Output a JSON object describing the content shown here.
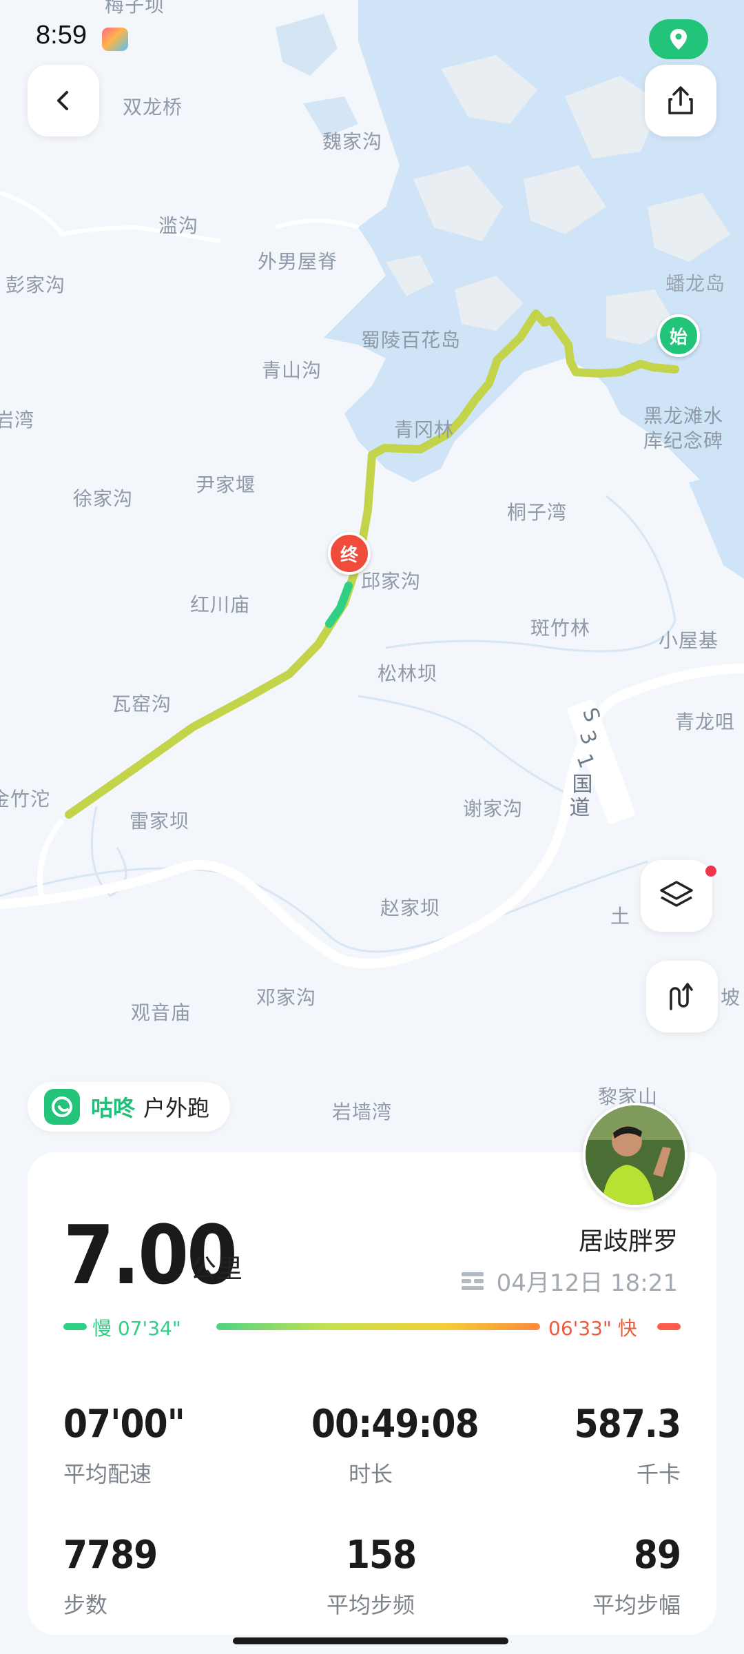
{
  "status": {
    "time": "8:59"
  },
  "map": {
    "labels": [
      "梅子坝",
      "双龙桥",
      "魏家沟",
      "滥沟",
      "外男屋脊",
      "彭家沟",
      "蟠龙岛",
      "蜀陵百花岛",
      "青山沟",
      "岩湾",
      "黑龙滩水",
      "库纪念碑",
      "青冈林",
      "尹家堰",
      "徐家沟",
      "桐子湾",
      "终",
      "邱家沟",
      "红川庙",
      "斑竹林",
      "小屋基",
      "松林坝",
      "瓦窑沟",
      "青龙咀",
      "金竹沱",
      "雷家坝",
      "谢家沟",
      "S",
      "3",
      "1",
      "国",
      "道",
      "赵家坝",
      "土",
      "观音庙",
      "邓家沟",
      "坡",
      "黎家山",
      "岩墙湾"
    ],
    "start_marker": "始",
    "end_marker": "终",
    "route_color": "#c3d34a"
  },
  "app": {
    "name": "咕咚",
    "activity": "户外跑"
  },
  "summary": {
    "distance": "7.00",
    "unit": "公里",
    "user": "居歧胖罗",
    "datetime": "04月12日 18:21",
    "pace_slow": "慢 07'34\"",
    "pace_fast": "06'33\" 快"
  },
  "stats": [
    {
      "value": "07'00\"",
      "label": "平均配速"
    },
    {
      "value": "00:49:08",
      "label": "时长"
    },
    {
      "value": "587.3",
      "label": "千卡"
    },
    {
      "value": "7789",
      "label": "步数"
    },
    {
      "value": "158",
      "label": "平均步频"
    },
    {
      "value": "89",
      "label": "平均步幅"
    }
  ],
  "colors": {
    "accent": "#22c47a",
    "slow": "#2fcf86",
    "fast": "#ff5a4a",
    "water": "#cfe4f6"
  }
}
